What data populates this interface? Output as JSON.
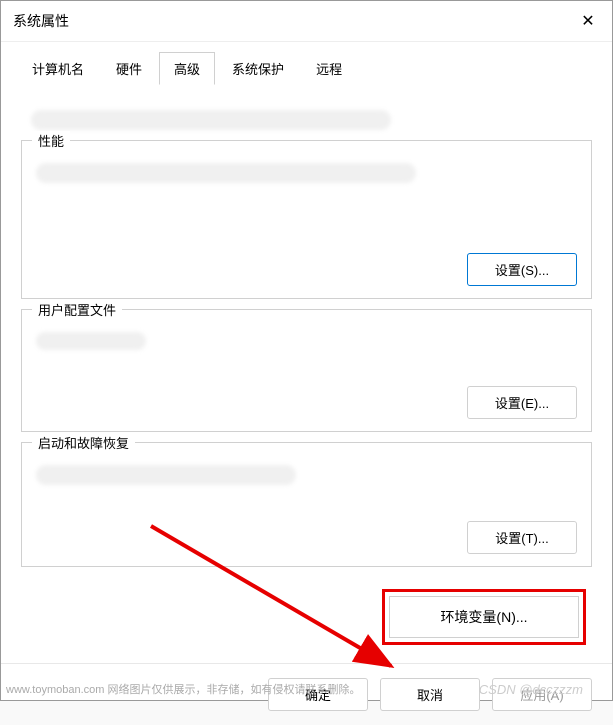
{
  "dialog": {
    "title": "系统属性"
  },
  "tabs": [
    {
      "label": "计算机名"
    },
    {
      "label": "硬件"
    },
    {
      "label": "高级",
      "active": true
    },
    {
      "label": "系统保护"
    },
    {
      "label": "远程"
    }
  ],
  "groups": {
    "performance": {
      "title": "性能",
      "button": "设置(S)..."
    },
    "userprofile": {
      "title": "用户配置文件",
      "button": "设置(E)..."
    },
    "startup": {
      "title": "启动和故障恢复",
      "button": "设置(T)..."
    }
  },
  "envvar": {
    "button": "环境变量(N)..."
  },
  "footer": {
    "ok": "确定",
    "cancel": "取消",
    "apply": "应用(A)"
  },
  "watermark": {
    "left": "www.toymoban.com  网络图片仅供展示，非存储，如有侵权请联系删除。",
    "right": "CSDN @dcczzzm"
  }
}
